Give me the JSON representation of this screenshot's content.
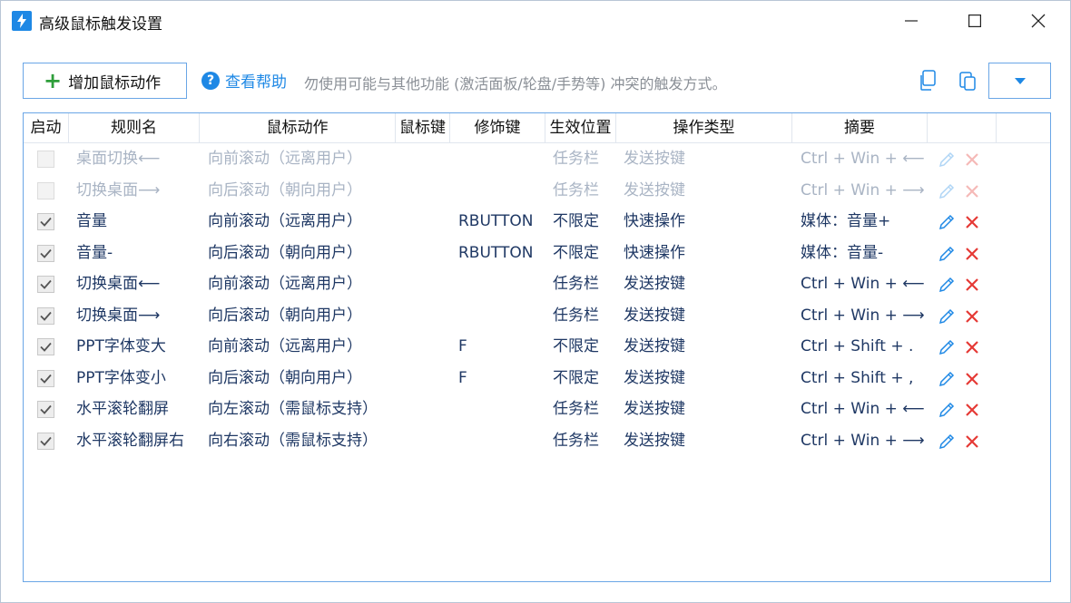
{
  "window": {
    "title": "高级鼠标触发设置"
  },
  "toolbar": {
    "add_label": "增加鼠标动作",
    "help_label": "查看帮助",
    "hint": "勿使用可能与其他功能 (激活面板/轮盘/手势等) 冲突的触发方式。"
  },
  "colors": {
    "accent": "#1e88e5",
    "add_green": "#2e9e3a",
    "delete_red": "#e53935",
    "text_navy": "#1f3864",
    "disabled_text": "#a9b4c4"
  },
  "icons": {
    "app": "lightning-icon",
    "add": "plus-icon",
    "help": "question-circle-icon",
    "copy": "copy-icon",
    "paste": "paste-icon",
    "dropdown": "caret-down-icon",
    "edit": "pencil-icon",
    "delete": "x-icon"
  },
  "table": {
    "headers": [
      "启动",
      "规则名",
      "鼠标动作",
      "鼠标键",
      "修饰键",
      "生效位置",
      "操作类型",
      "摘要"
    ],
    "rows": [
      {
        "enabled": false,
        "name": "桌面切换⟵",
        "action": "向前滚动（远离用户）",
        "button": "",
        "modifier": "",
        "scope": "任务栏",
        "op": "发送按键",
        "summary": "Ctrl + Win + ⟵"
      },
      {
        "enabled": false,
        "name": "切换桌面⟶",
        "action": "向后滚动（朝向用户）",
        "button": "",
        "modifier": "",
        "scope": "任务栏",
        "op": "发送按键",
        "summary": "Ctrl + Win + ⟶"
      },
      {
        "enabled": true,
        "name": "音量",
        "action": "向前滚动（远离用户）",
        "button": "",
        "modifier": "RBUTTON",
        "scope": "不限定",
        "op": "快速操作",
        "summary": "媒体：音量+"
      },
      {
        "enabled": true,
        "name": "音量-",
        "action": "向后滚动（朝向用户）",
        "button": "",
        "modifier": "RBUTTON",
        "scope": "不限定",
        "op": "快速操作",
        "summary": "媒体：音量-"
      },
      {
        "enabled": true,
        "name": "切换桌面⟵",
        "action": "向前滚动（远离用户）",
        "button": "",
        "modifier": "",
        "scope": "任务栏",
        "op": "发送按键",
        "summary": "Ctrl + Win + ⟵"
      },
      {
        "enabled": true,
        "name": "切换桌面⟶",
        "action": "向后滚动（朝向用户）",
        "button": "",
        "modifier": "",
        "scope": "任务栏",
        "op": "发送按键",
        "summary": "Ctrl + Win + ⟶"
      },
      {
        "enabled": true,
        "name": "PPT字体变大",
        "action": "向前滚动（远离用户）",
        "button": "",
        "modifier": "F",
        "scope": "不限定",
        "op": "发送按键",
        "summary": "Ctrl + Shift + ."
      },
      {
        "enabled": true,
        "name": "PPT字体变小",
        "action": "向后滚动（朝向用户）",
        "button": "",
        "modifier": "F",
        "scope": "不限定",
        "op": "发送按键",
        "summary": "Ctrl + Shift + ,"
      },
      {
        "enabled": true,
        "name": "水平滚轮翻屏",
        "action": "向左滚动（需鼠标支持）",
        "button": "",
        "modifier": "",
        "scope": "任务栏",
        "op": "发送按键",
        "summary": "Ctrl + Win + ⟵"
      },
      {
        "enabled": true,
        "name": "水平滚轮翻屏右",
        "action": "向右滚动（需鼠标支持）",
        "button": "",
        "modifier": "",
        "scope": "任务栏",
        "op": "发送按键",
        "summary": "Ctrl + Win + ⟶"
      }
    ]
  }
}
